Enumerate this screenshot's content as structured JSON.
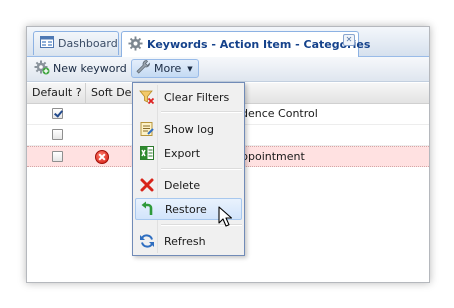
{
  "tabs": [
    {
      "label": "Dashboard",
      "icon": "dashboard-icon",
      "active": false
    },
    {
      "label": "Keywords - Action Item - Categories",
      "icon": "gear-icon",
      "active": true,
      "close_glyph": "✕"
    }
  ],
  "toolbar": {
    "new_label": "New keyword",
    "more_label": "More"
  },
  "grid": {
    "columns": [
      "Default ?",
      "Soft Del"
    ],
    "rows": [
      {
        "checked": true,
        "deleted": false,
        "name": "dence Control"
      },
      {
        "checked": false,
        "deleted": false,
        "name": ""
      },
      {
        "checked": false,
        "deleted": true,
        "name": "ppointment"
      }
    ]
  },
  "menu": {
    "items": [
      {
        "label": "Clear Filters",
        "icon": "clear-filter-icon"
      },
      {
        "label": "Show log",
        "icon": "log-icon"
      },
      {
        "label": "Export",
        "icon": "excel-icon"
      },
      {
        "label": "Delete",
        "icon": "red-x-icon"
      },
      {
        "label": "Restore",
        "icon": "restore-arrow-icon",
        "hovered": true
      },
      {
        "label": "Refresh",
        "icon": "refresh-icon"
      }
    ]
  },
  "colors": {
    "tab_text": "#15428b",
    "deleted_row": "#ffe1e1",
    "menu_hover": "#d2e4fb"
  }
}
